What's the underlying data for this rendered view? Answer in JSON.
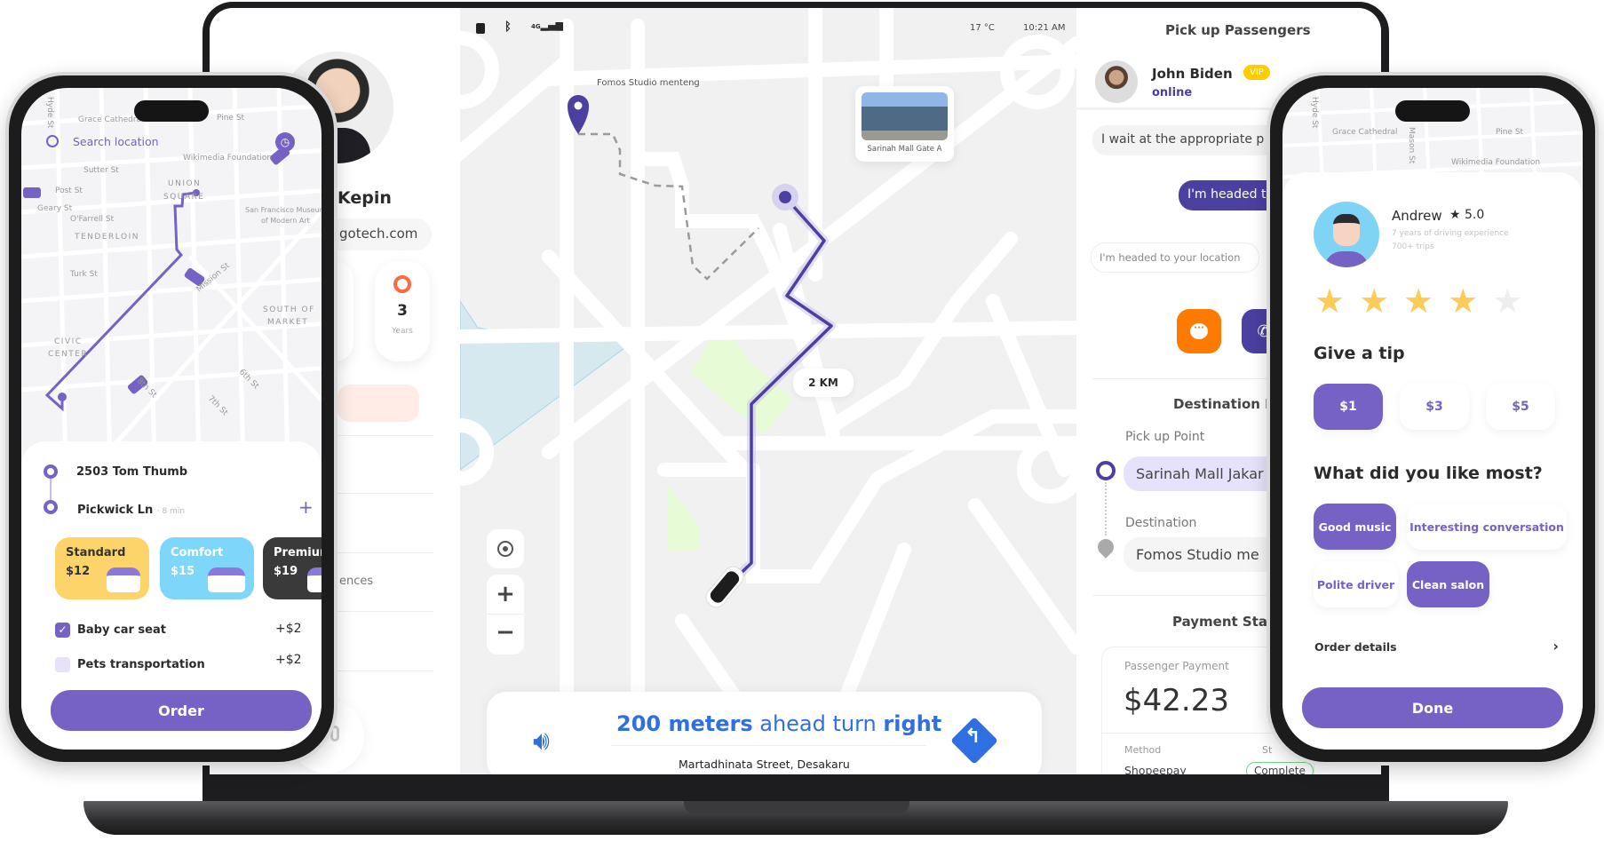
{
  "laptop": {
    "status_bar": {
      "temperature": "17 °C",
      "time": "10:21 AM",
      "network": "4G",
      "icons": [
        "lock-icon",
        "bluetooth-icon",
        "signal-icon"
      ]
    },
    "profile": {
      "name": "Kepin",
      "email": "gotech.com",
      "stats": [
        {
          "value": "3",
          "label": "Years",
          "icon": "steering-wheel-icon"
        }
      ],
      "menu_partial": "ences"
    },
    "map": {
      "destination_label": "Fomos Studio menteng",
      "pickup_card_label": "Sarinah Mall Gate A",
      "distance": "2 KM",
      "controls": [
        "locate-icon",
        "zoom-in-icon",
        "zoom-out-icon"
      ],
      "navigation": {
        "instruction_bold1": "200 meters",
        "instruction_mid": " ahead turn ",
        "instruction_bold2": "right",
        "street": "Martadhinata Street, Desakaru"
      }
    },
    "passenger_panel": {
      "title": "Pick up Passengers",
      "passenger": {
        "name": "John Biden",
        "badge": "VIP",
        "status": "online"
      },
      "messages": [
        {
          "from": "passenger",
          "text": "I wait at the appropriate p"
        },
        {
          "from": "driver",
          "text": "I'm headed t"
        },
        {
          "from": "input",
          "text": "I'm headed to your location"
        }
      ],
      "destination_title": "Destination In",
      "pickup_label": "Pick up Point",
      "pickup_value": "Sarinah Mall Jakar",
      "destination_label": "Destination",
      "destination_value": "Fomos Studio me",
      "payment_title": "Payment Sta",
      "payment_label": "Passenger Payment",
      "amount": "$42.23",
      "method_label": "Method",
      "method_value": "Shopeepay",
      "status_label": "St",
      "status_value": "Complete"
    }
  },
  "left_phone": {
    "search_placeholder": "Search location",
    "map_labels": [
      "Hyde St",
      "Grace Cathedral",
      "Pine St",
      "Wikimedia Foundation",
      "Sutter St",
      "Post St",
      "Geary St",
      "O'Farrell St",
      "UNION",
      "SQUARE",
      "TENDERLOIN",
      "San Francisco Museum",
      "of Modern Art",
      "Turk St",
      "Mission St",
      "SOUTH OF",
      "MARKET",
      "CIVIC",
      "CENTER",
      "8th St",
      "7th St",
      "6th St"
    ],
    "origin": "2503 Tom Thumb",
    "destination": "Pickwick Ln",
    "eta": "· 8 min",
    "ride_options": [
      {
        "name": "Standard",
        "price": "$12",
        "color": "#fdd46a"
      },
      {
        "name": "Comfort",
        "price": "$15",
        "color": "#7fd6fb"
      },
      {
        "name": "Premium",
        "price": "$19",
        "color": "#3a3a3a"
      }
    ],
    "extras": [
      {
        "label": "Baby car seat",
        "price": "+$2",
        "checked": true
      },
      {
        "label": "Pets transportation",
        "price": "+$2",
        "checked": false
      }
    ],
    "order_button": "Order"
  },
  "right_phone": {
    "map_labels": [
      "Hyde St",
      "Grace Cathedral",
      "Mason St",
      "Pine St",
      "Wikimedia Foundation"
    ],
    "driver": {
      "name": "Andrew",
      "rating": "★ 5.0",
      "experience": "7 years of driving experience",
      "trips": "700+ trips"
    },
    "stars": {
      "value": 4,
      "max": 5
    },
    "tip_title": "Give a tip",
    "tips": [
      {
        "label": "$1",
        "selected": true
      },
      {
        "label": "$3",
        "selected": false
      },
      {
        "label": "$5",
        "selected": false
      }
    ],
    "like_title": "What did you like most?",
    "chips": [
      {
        "label": "Good music",
        "selected": true
      },
      {
        "label": "Interesting conversation",
        "selected": false
      },
      {
        "label": "Polite driver",
        "selected": false
      },
      {
        "label": "Clean salon",
        "selected": true
      }
    ],
    "order_details": "Order details",
    "done_button": "Done"
  },
  "colors": {
    "accent": "#7661c4",
    "route": "#4b3fa0",
    "nav_blue": "#2f6fe0",
    "orange": "#ff7a00",
    "vip": "#ffcc00"
  }
}
